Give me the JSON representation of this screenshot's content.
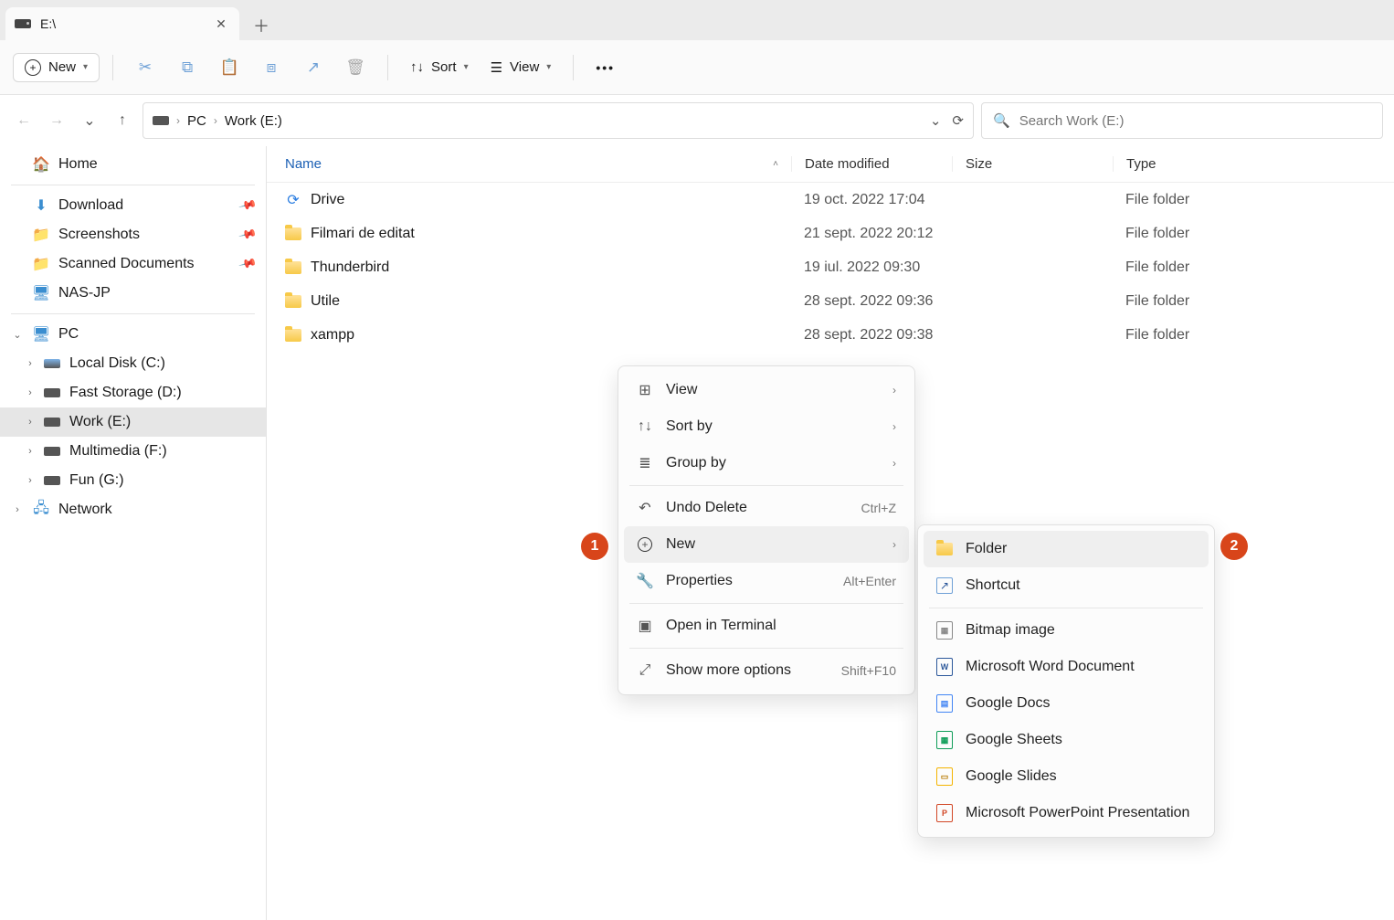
{
  "tab": {
    "title": "E:\\"
  },
  "toolbar": {
    "new_label": "New",
    "sort_label": "Sort",
    "view_label": "View"
  },
  "breadcrumb": {
    "segments": [
      "PC",
      "Work (E:)"
    ]
  },
  "search": {
    "placeholder": "Search Work (E:)"
  },
  "sidebar": {
    "home": "Home",
    "quick": [
      {
        "label": "Download"
      },
      {
        "label": "Screenshots"
      },
      {
        "label": "Scanned Documents"
      },
      {
        "label": "NAS-JP"
      }
    ],
    "pc_label": "PC",
    "drives": [
      {
        "label": "Local Disk (C:)"
      },
      {
        "label": "Fast Storage (D:)"
      },
      {
        "label": "Work (E:)",
        "selected": true
      },
      {
        "label": "Multimedia (F:)"
      },
      {
        "label": "Fun (G:)"
      }
    ],
    "network_label": "Network"
  },
  "columns": {
    "name": "Name",
    "date": "Date modified",
    "size": "Size",
    "type": "Type"
  },
  "rows": [
    {
      "name": "Drive",
      "date": "19 oct. 2022 17:04",
      "type": "File folder",
      "special": true
    },
    {
      "name": "Filmari de editat",
      "date": "21 sept. 2022 20:12",
      "type": "File folder"
    },
    {
      "name": "Thunderbird",
      "date": "19 iul. 2022 09:30",
      "type": "File folder"
    },
    {
      "name": "Utile",
      "date": "28 sept. 2022 09:36",
      "type": "File folder"
    },
    {
      "name": "xampp",
      "date": "28 sept. 2022 09:38",
      "type": "File folder"
    }
  ],
  "context_menu": {
    "view": "View",
    "sort_by": "Sort by",
    "group_by": "Group by",
    "undo": "Undo Delete",
    "undo_shortcut": "Ctrl+Z",
    "new": "New",
    "properties": "Properties",
    "properties_shortcut": "Alt+Enter",
    "terminal": "Open in Terminal",
    "more": "Show more options",
    "more_shortcut": "Shift+F10"
  },
  "new_submenu": [
    {
      "label": "Folder",
      "kind": "folder"
    },
    {
      "label": "Shortcut",
      "kind": "shortcut"
    },
    {
      "label": "Bitmap image",
      "kind": "bmp"
    },
    {
      "label": "Microsoft Word Document",
      "kind": "word"
    },
    {
      "label": "Google Docs",
      "kind": "docs"
    },
    {
      "label": "Google Sheets",
      "kind": "sheets"
    },
    {
      "label": "Google Slides",
      "kind": "slides"
    },
    {
      "label": "Microsoft PowerPoint Presentation",
      "kind": "ppt"
    }
  ],
  "annotations": {
    "one": "1",
    "two": "2"
  }
}
